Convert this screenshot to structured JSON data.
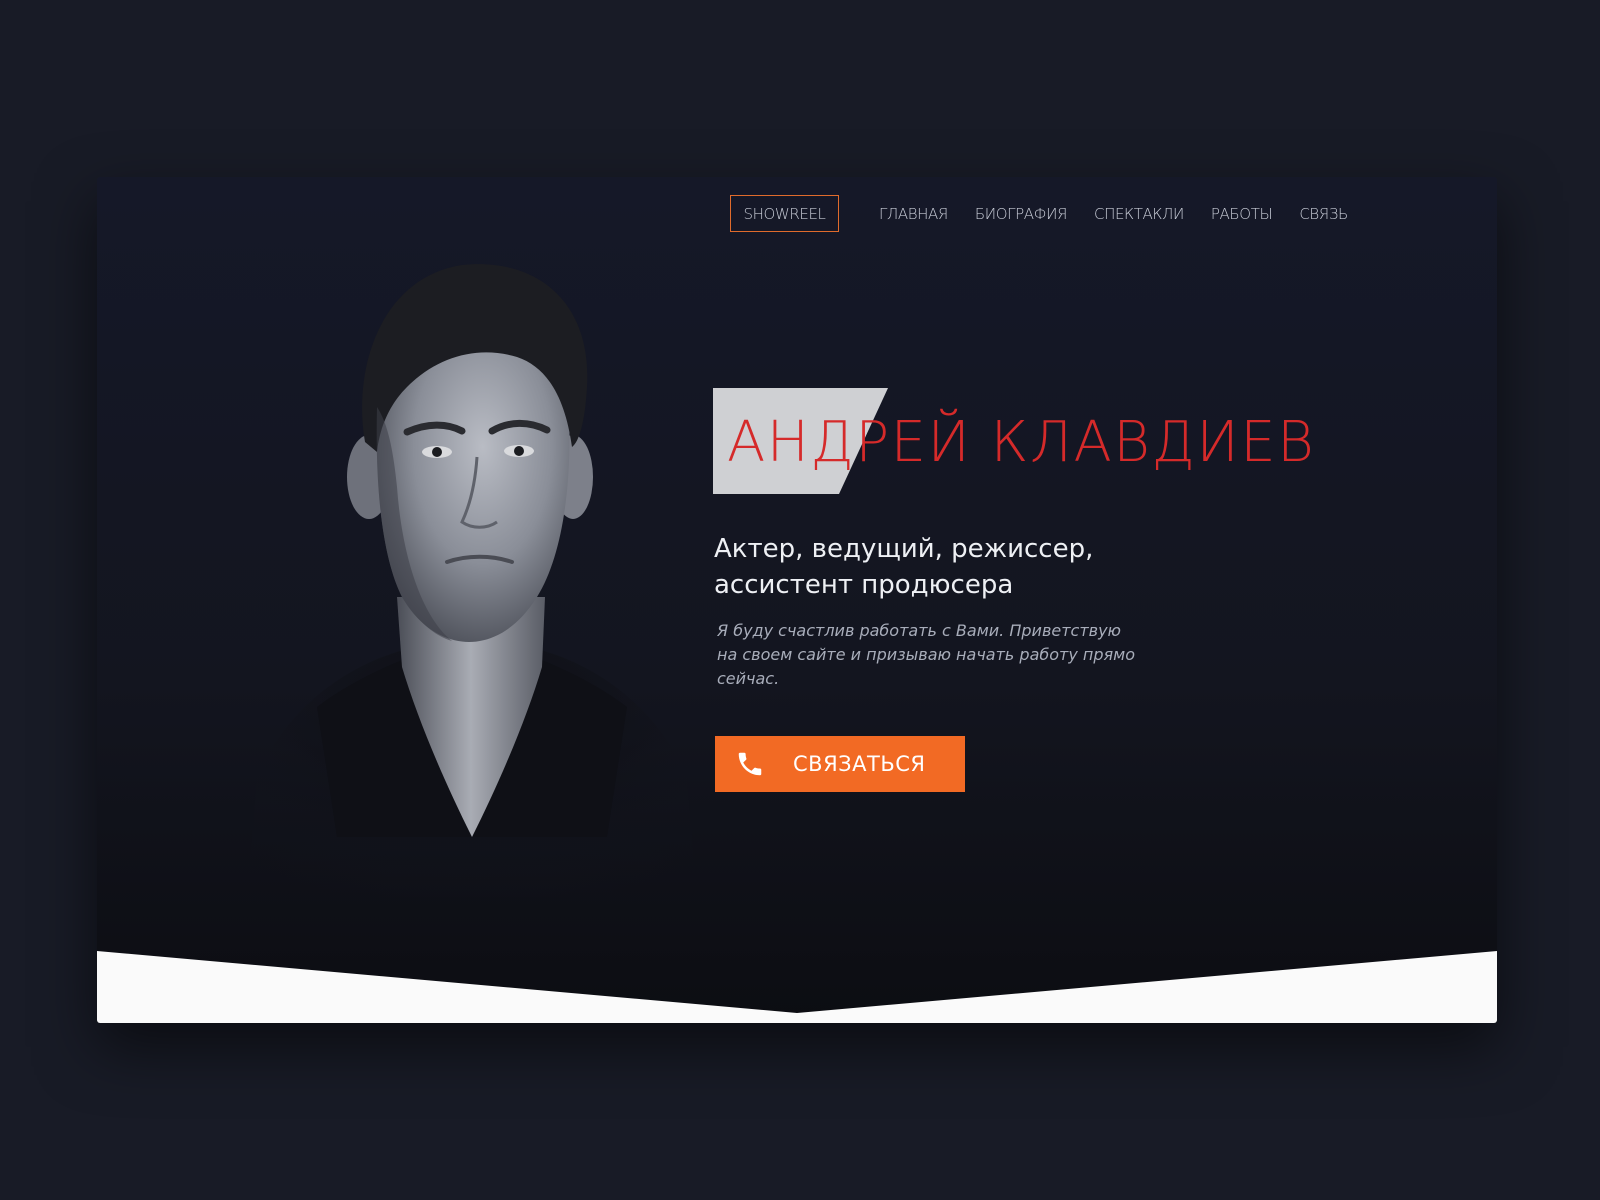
{
  "nav": {
    "showreel_label": "SHOWREEL",
    "links": [
      "ГЛАВНАЯ",
      "БИОГРАФИЯ",
      "СПЕКТАКЛИ",
      "РАБОТЫ",
      "СВЯЗЬ"
    ]
  },
  "hero": {
    "name": "АНДРЕЙ КЛАВДИЕВ",
    "subtitle_line1": "Актер, ведущий, режиссер,",
    "subtitle_line2": "ассистент продюсера",
    "tagline_line1": "Я буду счастлив работать с Вами. Приветствую",
    "tagline_line2": "на своем сайте и призываю начать работу прямо",
    "tagline_line3": "сейчас.",
    "cta_label": "СВЯЗАТЬСЯ",
    "cta_icon": "phone-icon"
  },
  "colors": {
    "page_background": "#181b26",
    "card_background": "#151828",
    "accent_orange": "#f26a24",
    "name_red": "#d52a2a",
    "name_block_gray": "#cfd0d3",
    "bottom_band": "#fafafa"
  }
}
